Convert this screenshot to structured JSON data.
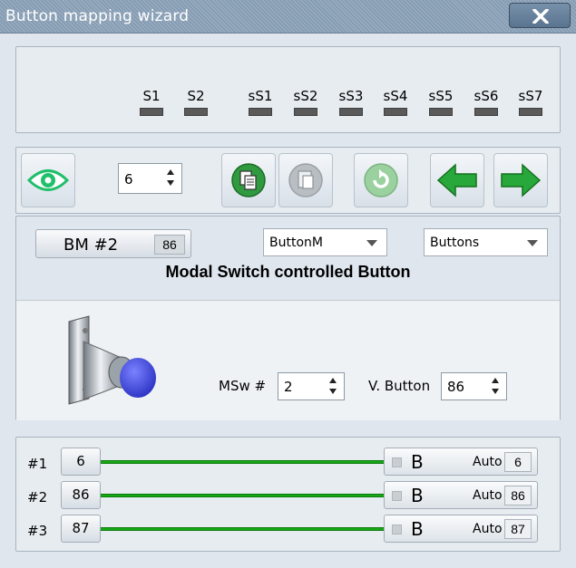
{
  "window": {
    "title": "Button mapping wizard",
    "close_icon": "close-icon"
  },
  "leds": [
    {
      "label": "S1"
    },
    {
      "label": "S2"
    },
    {
      "label": "sS1"
    },
    {
      "label": "sS2"
    },
    {
      "label": "sS3"
    },
    {
      "label": "sS4"
    },
    {
      "label": "sS5"
    },
    {
      "label": "sS6"
    },
    {
      "label": "sS7"
    }
  ],
  "toolbar": {
    "view_icon": "eye-icon",
    "spin_value": "6",
    "copy_icon": "copy-icon",
    "paste_icon": "paste-icon",
    "reset_icon": "refresh-icon",
    "prev_icon": "arrow-left-icon",
    "next_icon": "arrow-right-icon"
  },
  "mapping": {
    "button_label": "BM #2",
    "button_badge": "86",
    "type_combo": "ButtonM",
    "category_combo": "Buttons",
    "heading": "Modal Switch controlled Button",
    "msw_label": "MSw #",
    "msw_value": "2",
    "vbutton_label": "V. Button",
    "vbutton_value": "86"
  },
  "rows": [
    {
      "num": "#1",
      "id": "6",
      "target": "B",
      "auto": "Auto",
      "value": "6"
    },
    {
      "num": "#2",
      "id": "86",
      "target": "B",
      "auto": "Auto",
      "value": "86"
    },
    {
      "num": "#3",
      "id": "87",
      "target": "B",
      "auto": "Auto",
      "value": "87"
    }
  ],
  "colors": {
    "accent_green": "#16a916",
    "title_bar": "#8aa0b6"
  }
}
